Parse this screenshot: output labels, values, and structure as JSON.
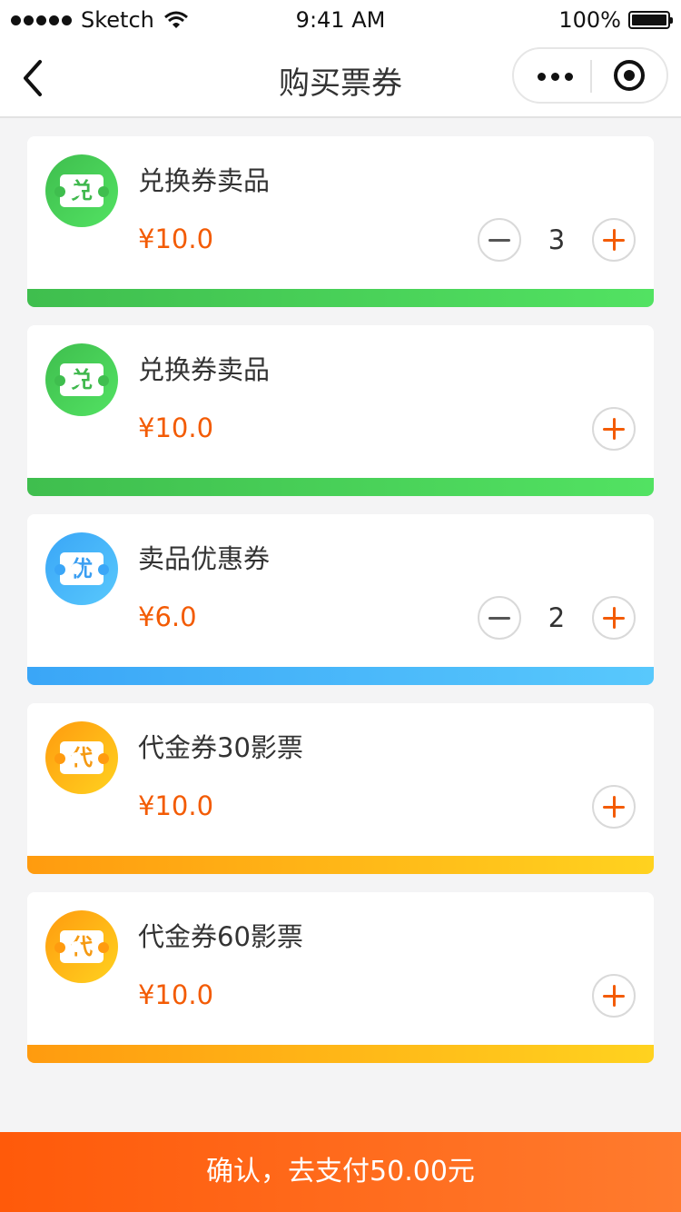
{
  "status_bar": {
    "carrier": "Sketch",
    "time": "9:41 AM",
    "battery": "100%"
  },
  "nav": {
    "title": "购买票券",
    "back_icon": "chevron-left-icon",
    "more_icon": "more-dots-icon",
    "close_icon": "target-icon"
  },
  "items": [
    {
      "name": "兑换券卖品",
      "price": "¥10.0",
      "badge": "兑",
      "qty": "3",
      "theme": "green"
    },
    {
      "name": "兑换券卖品",
      "price": "¥10.0",
      "badge": "兑",
      "qty": null,
      "theme": "green"
    },
    {
      "name": "卖品优惠券",
      "price": "¥6.0",
      "badge": "优",
      "qty": "2",
      "theme": "blue"
    },
    {
      "name": "代金券30影票",
      "price": "¥10.0",
      "badge": "代",
      "qty": null,
      "theme": "orange"
    },
    {
      "name": "代金券60影票",
      "price": "¥10.0",
      "badge": "代",
      "qty": null,
      "theme": "orange"
    }
  ],
  "themes": {
    "green": {
      "start": "#3fbe4e",
      "end": "#52e262",
      "text": "#3fb84d"
    },
    "blue": {
      "start": "#3aa6f7",
      "end": "#58c8fc",
      "text": "#3a9ef2"
    },
    "orange": {
      "start": "#ff9b0f",
      "end": "#ffd21f",
      "text": "#f59a12"
    }
  },
  "colors": {
    "accent": "#f35b04"
  },
  "confirm": {
    "label": "确认，去支付50.00元"
  }
}
